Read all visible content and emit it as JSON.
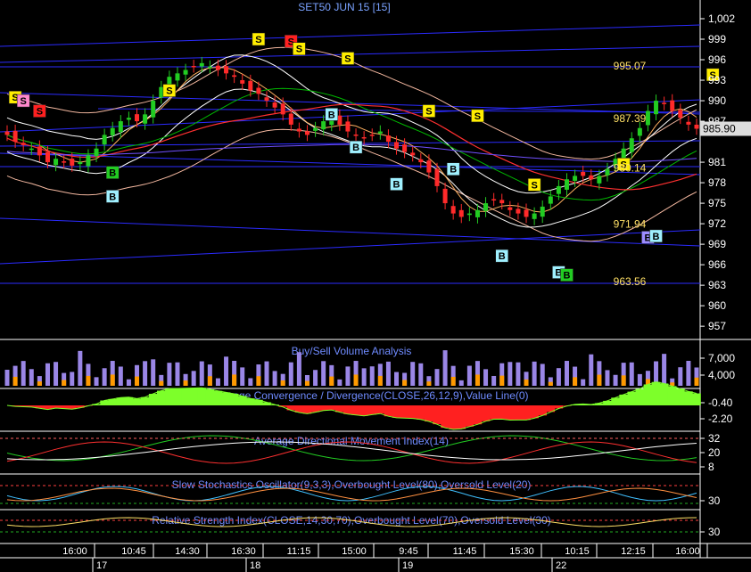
{
  "chart_data": {
    "type": "candlestick",
    "title": "SET50 JUN 15   [15]",
    "last_price_label": "985.90",
    "last_price": 985.9,
    "ylim": [
      955,
      1003
    ],
    "price_ticks": [
      {
        "v": 1002,
        "label": "1,002"
      },
      {
        "v": 999,
        "label": "999"
      },
      {
        "v": 996,
        "label": "996"
      },
      {
        "v": 993,
        "label": "993"
      },
      {
        "v": 990,
        "label": "990"
      },
      {
        "v": 987,
        "label": "987"
      },
      {
        "v": 981,
        "label": "981"
      },
      {
        "v": 978,
        "label": "978"
      },
      {
        "v": 975,
        "label": "975"
      },
      {
        "v": 972,
        "label": "972"
      },
      {
        "v": 969,
        "label": "969"
      },
      {
        "v": 966,
        "label": "966"
      },
      {
        "v": 963,
        "label": "963"
      },
      {
        "v": 960,
        "label": "960"
      },
      {
        "v": 957,
        "label": "957"
      }
    ],
    "levels": [
      {
        "value": 995.07,
        "label": "995.07"
      },
      {
        "value": 987.39,
        "label": "987.39"
      },
      {
        "value": 980.14,
        "label": "980.14"
      },
      {
        "value": 971.94,
        "label": "971.94"
      },
      {
        "value": 963.56,
        "label": "963.56"
      }
    ],
    "closes": [
      985,
      984,
      983.5,
      983,
      982,
      981,
      981.5,
      981,
      980.5,
      981,
      982,
      983,
      985,
      986,
      987,
      987.5,
      987,
      988,
      990,
      992,
      993.5,
      994,
      994.5,
      995,
      995.5,
      995,
      994.5,
      994,
      993.5,
      992.5,
      991.5,
      991,
      990,
      989,
      988,
      986.5,
      985.5,
      985,
      986,
      987,
      987.5,
      986.5,
      985.5,
      985,
      984.5,
      985,
      985.5,
      984,
      983,
      982.5,
      982,
      981,
      979.5,
      977.5,
      975,
      973.5,
      973,
      973.5,
      974,
      975,
      975.5,
      975,
      974,
      973.5,
      973,
      973.5,
      974.5,
      976,
      977.5,
      978.5,
      979,
      979,
      978.5,
      979,
      980,
      981.5,
      983,
      984.5,
      986,
      988.5,
      990,
      989.5,
      988.5,
      987.5,
      986.5,
      985.9
    ],
    "signals": [
      {
        "i": 1,
        "type": "S",
        "color": "yellow",
        "price": 990.5
      },
      {
        "i": 2,
        "type": "S",
        "color": "pink",
        "price": 990
      },
      {
        "i": 4,
        "type": "S",
        "color": "red",
        "price": 988.5
      },
      {
        "i": 13,
        "type": "B",
        "color": "cyan",
        "price": 976
      },
      {
        "i": 13,
        "type": "B",
        "color": "green",
        "price": 979.5
      },
      {
        "i": 20,
        "type": "S",
        "color": "yellow",
        "price": 991.5
      },
      {
        "i": 31,
        "type": "S",
        "color": "yellow",
        "price": 999
      },
      {
        "i": 35,
        "type": "S",
        "color": "red",
        "price": 998.7
      },
      {
        "i": 36,
        "type": "S",
        "color": "yellow",
        "price": 997.6
      },
      {
        "i": 40,
        "type": "B",
        "color": "cyan",
        "price": 988
      },
      {
        "i": 42,
        "type": "S",
        "color": "yellow",
        "price": 996.2
      },
      {
        "i": 43,
        "type": "B",
        "color": "cyan",
        "price": 983.2
      },
      {
        "i": 48,
        "type": "B",
        "color": "cyan",
        "price": 977.8
      },
      {
        "i": 52,
        "type": "S",
        "color": "yellow",
        "price": 988.5
      },
      {
        "i": 55,
        "type": "B",
        "color": "cyan",
        "price": 980
      },
      {
        "i": 58,
        "type": "S",
        "color": "yellow",
        "price": 987.8
      },
      {
        "i": 61,
        "type": "B",
        "color": "cyan",
        "price": 967.3
      },
      {
        "i": 65,
        "type": "S",
        "color": "yellow",
        "price": 977.7
      },
      {
        "i": 68,
        "type": "B",
        "color": "cyan",
        "price": 964.9
      },
      {
        "i": 69,
        "type": "B",
        "color": "green",
        "price": 964.5
      },
      {
        "i": 76,
        "type": "S",
        "color": "yellow",
        "price": 980.7
      },
      {
        "i": 79,
        "type": "B",
        "color": "purple",
        "price": 970
      },
      {
        "i": 80,
        "type": "B",
        "color": "cyan",
        "price": 970.2
      },
      {
        "i": 87,
        "type": "S",
        "color": "yellow",
        "price": 993.8
      }
    ],
    "x_ticks": [
      "16:00",
      "10:45",
      "14:30",
      "16:30",
      "11:15",
      "15:00",
      "9:45",
      "11:45",
      "15:30",
      "10:15",
      "12:15",
      "16:00"
    ],
    "day_labels": [
      "17",
      "18",
      "19",
      "22"
    ],
    "panels": [
      {
        "title": "Buy/Sell Volume Analysis",
        "ticks": [
          "7,000",
          "4,000"
        ]
      },
      {
        "title": "Moving Average Convergence / Divergence(CLOSE,26,12,9),Value Line(0)",
        "ticks": [
          "-0.40",
          "-2.20"
        ]
      },
      {
        "title": "Average Directional Movement Index(14)",
        "ticks": [
          "32",
          "20",
          "8"
        ]
      },
      {
        "title": "Slow Stochastics Oscillator(9,3,3),Overbought Level(80),Oversold Level(20)",
        "ticks": [
          "30"
        ]
      },
      {
        "title": "Relative Strength Index(CLOSE,14,30,70),Overbought Level(70),Oversold Level(30)",
        "ticks": [
          "30"
        ]
      }
    ],
    "colors": {
      "up": "#22cc22",
      "down": "#ff2a2a",
      "ma_green": "#00b800",
      "ma_red": "#ff3030",
      "ma_white": "#ffffff",
      "ma_orange": "#ffb060",
      "ma_purple": "#7050ff",
      "band": "#f4b8a0",
      "grid": "#2b2bff"
    }
  }
}
